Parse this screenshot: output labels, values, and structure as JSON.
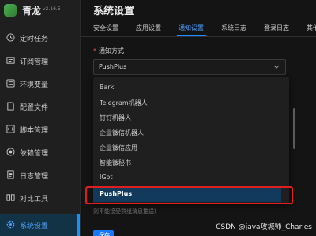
{
  "app": {
    "name": "青龙",
    "version": "v2.16.5"
  },
  "sidebar": {
    "items": [
      {
        "label": "定时任务",
        "icon": "clock-icon"
      },
      {
        "label": "订阅管理",
        "icon": "subscription-icon"
      },
      {
        "label": "环境变量",
        "icon": "variable-icon"
      },
      {
        "label": "配置文件",
        "icon": "file-icon"
      },
      {
        "label": "脚本管理",
        "icon": "script-icon"
      },
      {
        "label": "依赖管理",
        "icon": "dependency-icon"
      },
      {
        "label": "日志管理",
        "icon": "log-icon"
      },
      {
        "label": "对比工具",
        "icon": "compare-icon"
      },
      {
        "label": "系统设置",
        "icon": "settings-icon",
        "active": true
      }
    ]
  },
  "main": {
    "title": "系统设置",
    "tabs": [
      "安全设置",
      "应用设置",
      "通知设置",
      "系统日志",
      "登录日志",
      "其他"
    ],
    "active_tab": "通知设置",
    "form": {
      "label": "通知方式",
      "required_mark": "*",
      "selected": "PushPlus"
    },
    "dropdown_options": [
      "Bark",
      "Telegram机器人",
      "钉钉机器人",
      "企业微信机器人",
      "企业微信应用",
      "智能微秘书",
      "IGot",
      "PushPlus"
    ],
    "selected_option": "PushPlus",
    "hint_text": "则不能接受群组消息推送)",
    "save_label": "保存"
  },
  "watermark": "CSDN @java攻城师_Charles",
  "colors": {
    "accent": "#1890ff",
    "highlight_border": "#e01e1e",
    "background": "#141414",
    "sidebar": "#1f1f1f"
  }
}
